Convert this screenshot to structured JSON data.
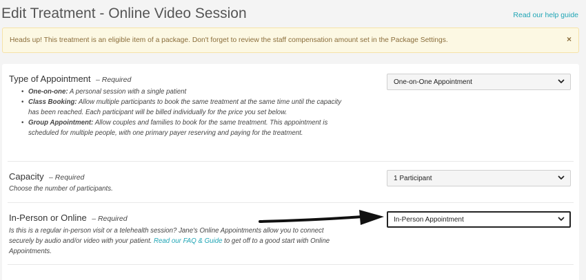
{
  "header": {
    "title": "Edit Treatment - Online Video Session",
    "help_link": "Read our help guide"
  },
  "alert": {
    "text": "Heads up! This treatment is an eligible item of a package. Don't forget to review the staff compensation amount set in the Package Settings.",
    "close_symbol": "×"
  },
  "form": {
    "required_marker": "– Required",
    "type_of_appointment": {
      "label": "Type of Appointment",
      "options_help": [
        {
          "term": "One-on-one:",
          "text": " A personal session with a single patient"
        },
        {
          "term": "Class Booking:",
          "text": " Allow multiple participants to book the same treatment at the same time until the capacity has been reached. Each participant will be billed individually for the price you set below."
        },
        {
          "term": "Group Appointment:",
          "text": " Allow couples and families to book for the same treatment. This appointment is scheduled for multiple people, with one primary payer reserving and paying for the treatment."
        }
      ],
      "selected": "One-on-One Appointment"
    },
    "capacity": {
      "label": "Capacity",
      "help": "Choose the number of participants.",
      "selected": "1 Participant"
    },
    "in_person_or_online": {
      "label": "In-Person or Online",
      "help_before": "Is this is a regular in-person visit or a telehealth session? Jane's Online Appointments allow you to connect securely by audio and/or video with your patient. ",
      "help_link": "Read our FAQ & Guide",
      "help_after": " to get off to a good start with Online Appointments.",
      "selected": "In-Person Appointment"
    }
  },
  "colors": {
    "accent": "#1fa5b5",
    "alert_bg": "#fcf8e3",
    "alert_text": "#8a6d3b",
    "annotation_arrow": "#111111"
  }
}
